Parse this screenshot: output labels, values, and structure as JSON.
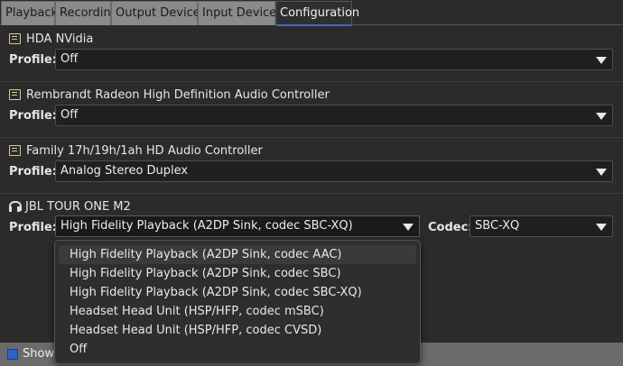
{
  "tabs": [
    {
      "label": "Playback"
    },
    {
      "label": "Recording"
    },
    {
      "label": "Output Devices"
    },
    {
      "label": "Input Devices"
    },
    {
      "label": "Configuration"
    }
  ],
  "cards": [
    {
      "name": "HDA NVidia",
      "profile_label": "Profile:",
      "profile": "Off"
    },
    {
      "name": "Rembrandt Radeon High Definition Audio Controller",
      "profile_label": "Profile:",
      "profile": "Off"
    },
    {
      "name": "Family 17h/19h/1ah HD Audio Controller",
      "profile_label": "Profile:",
      "profile": "Analog Stereo Duplex"
    },
    {
      "name": "JBL TOUR ONE M2",
      "profile_label": "Profile:",
      "profile": "High Fidelity Playback (A2DP Sink, codec SBC-XQ)",
      "codec_label": "Codec:",
      "codec": "SBC-XQ"
    }
  ],
  "popup": {
    "items": [
      "High Fidelity Playback (A2DP Sink, codec AAC)",
      "High Fidelity Playback (A2DP Sink, codec SBC)",
      "High Fidelity Playback (A2DP Sink, codec SBC-XQ)",
      "Headset Head Unit (HSP/HFP, codec mSBC)",
      "Headset Head Unit (HSP/HFP, codec CVSD)",
      "Off"
    ]
  },
  "bottom": {
    "show_label": "Show"
  },
  "colors": {
    "accent": "#3e6fbf",
    "checkbox": "#2d62c8"
  }
}
